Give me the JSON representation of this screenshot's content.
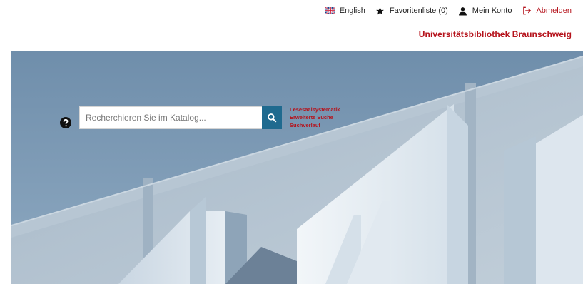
{
  "header": {
    "nav": {
      "language": {
        "label": "English",
        "icon": "uk-flag-icon"
      },
      "favorites": {
        "label": "Favoritenliste (0)",
        "icon": "star-icon"
      },
      "account": {
        "label": "Mein Konto",
        "icon": "user-icon"
      },
      "logout": {
        "label": "Abmelden",
        "icon": "sign-out-icon"
      }
    },
    "brand": "Universitätsbibliothek Braunschweig"
  },
  "search": {
    "placeholder": "Recherchieren Sie im Katalog...",
    "value": "",
    "help_icon": "question-circle-icon",
    "button_icon": "search-icon"
  },
  "quick_links": [
    {
      "label": "Lesesaalsystematik"
    },
    {
      "label": "Erweiterte Suche"
    },
    {
      "label": "Suchverlauf"
    }
  ],
  "colors": {
    "accent_red": "#b5121b",
    "search_button": "#1f6a8f",
    "hero_sky": "#7f9bb5"
  }
}
